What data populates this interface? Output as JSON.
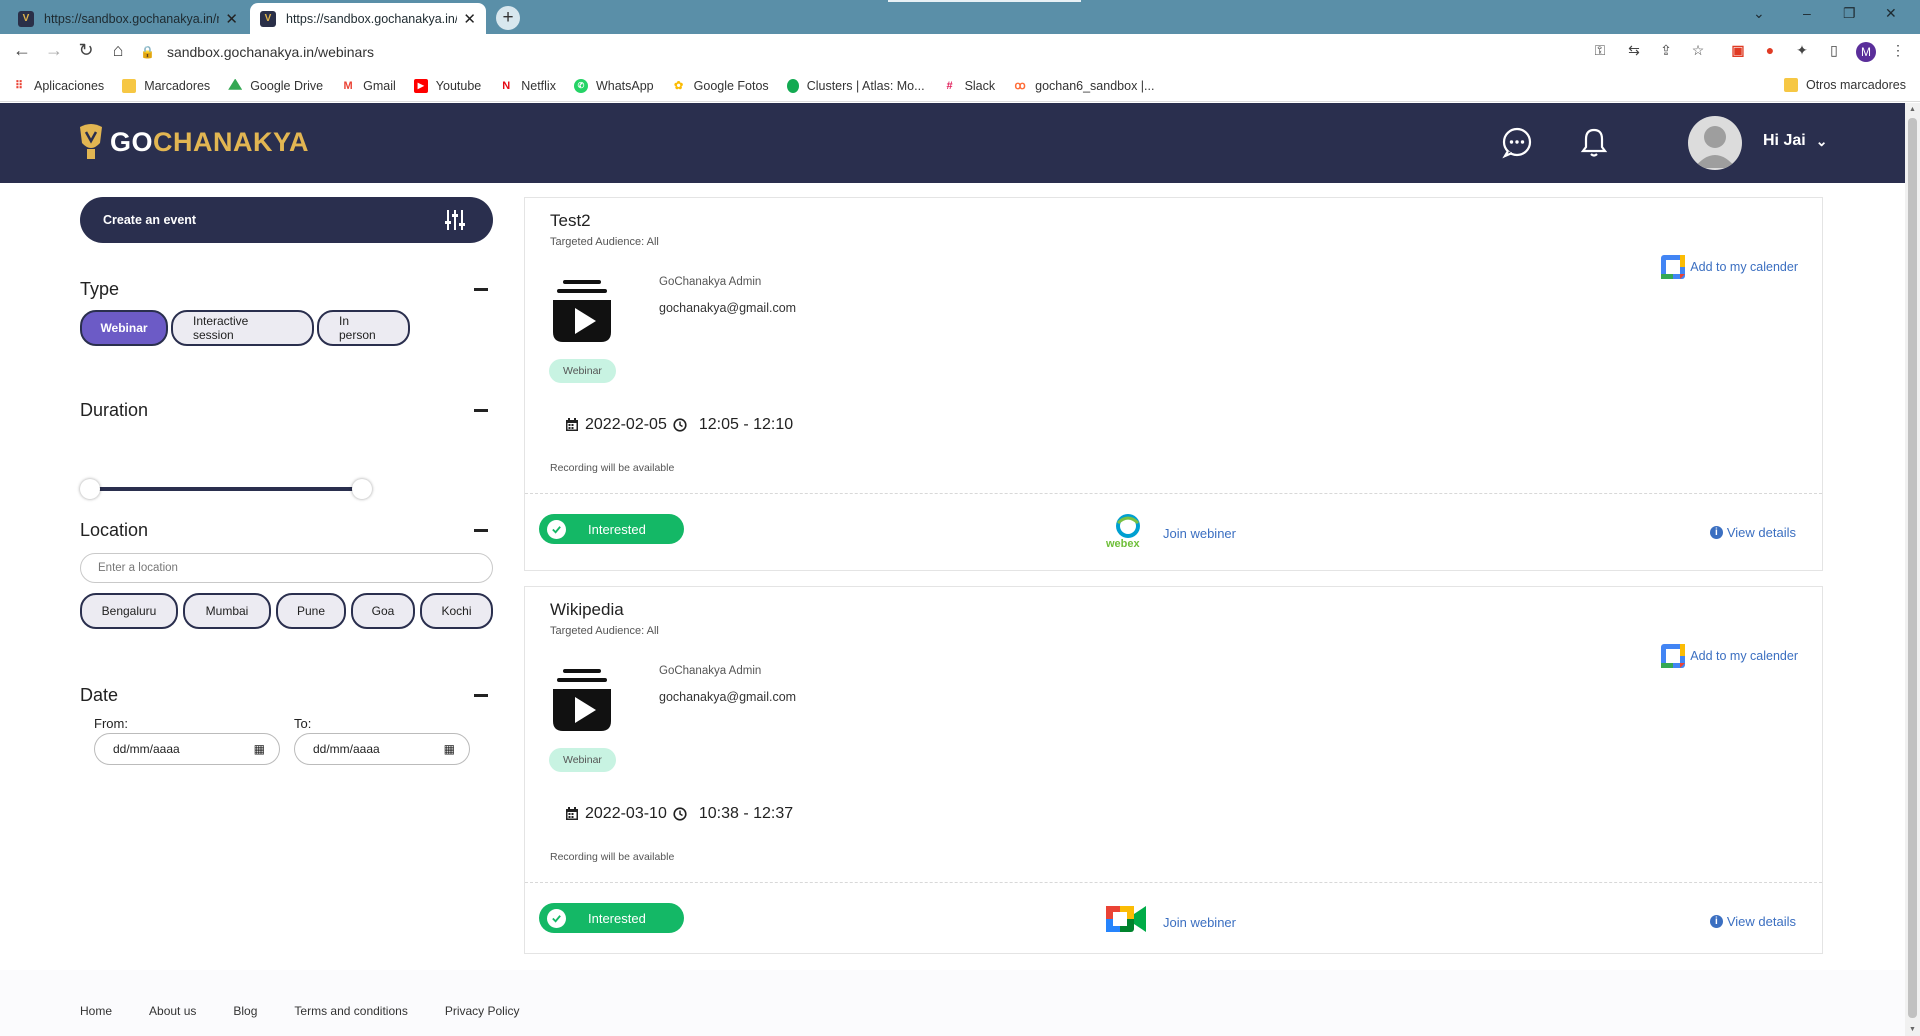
{
  "browser": {
    "tabs": [
      {
        "title": "https://sandbox.gochanakya.in/m",
        "active": false
      },
      {
        "title": "https://sandbox.gochanakya.in/w",
        "active": true
      }
    ],
    "address": "sandbox.gochanakya.in/webinars",
    "bookmarks": [
      {
        "label": "Aplicaciones",
        "icon": "apps-grid-icon"
      },
      {
        "label": "Marcadores",
        "icon": "folder-icon"
      },
      {
        "label": "Google Drive",
        "icon": "google-drive-icon"
      },
      {
        "label": "Gmail",
        "icon": "gmail-icon"
      },
      {
        "label": "Youtube",
        "icon": "youtube-icon"
      },
      {
        "label": "Netflix",
        "icon": "netflix-icon"
      },
      {
        "label": "WhatsApp",
        "icon": "whatsapp-icon"
      },
      {
        "label": "Google Fotos",
        "icon": "google-photos-icon"
      },
      {
        "label": "Clusters | Atlas: Mo...",
        "icon": "mongodb-icon"
      },
      {
        "label": "Slack",
        "icon": "slack-icon"
      },
      {
        "label": "gochan6_sandbox |...",
        "icon": "postman-icon"
      }
    ],
    "other_bookmarks": "Otros marcadores",
    "profile_initial": "M"
  },
  "site": {
    "logo_text_1": "GO",
    "logo_text_2": "CHANAKYA",
    "greeting": "Hi Jai"
  },
  "sidebar": {
    "create_event": "Create an event",
    "type": {
      "heading": "Type",
      "options": [
        {
          "label": "Webinar",
          "selected": true
        },
        {
          "label": "Interactive session",
          "selected": false
        },
        {
          "label": "In person",
          "selected": false
        }
      ]
    },
    "duration": {
      "heading": "Duration",
      "range_min": 0,
      "range_max": 1
    },
    "location": {
      "heading": "Location",
      "placeholder": "Enter a location",
      "cities": [
        "Bengaluru",
        "Mumbai",
        "Pune",
        "Goa",
        "Kochi"
      ]
    },
    "date": {
      "heading": "Date",
      "from_label": "From:",
      "to_label": "To:",
      "from_value": "dd/mm/aaaa",
      "to_value": "dd/mm/aaaa"
    }
  },
  "events": [
    {
      "title": "Test2",
      "audience": "Targeted Audience: All",
      "calendar_link": "Add to my calender",
      "host_name": "GoChanakya Admin",
      "host_email": "gochanakya@gmail.com",
      "type": "Webinar",
      "date": "2022-02-05",
      "time": "12:05 - 12:10",
      "recording_note": "Recording will be available",
      "interest_label": "Interested",
      "platform": "webex",
      "join_label": "Join webiner",
      "details_label": "View details"
    },
    {
      "title": "Wikipedia",
      "audience": "Targeted Audience: All",
      "calendar_link": "Add to my calender",
      "host_name": "GoChanakya Admin",
      "host_email": "gochanakya@gmail.com",
      "type": "Webinar",
      "date": "2022-03-10",
      "time": "10:38 - 12:37",
      "recording_note": "Recording will be available",
      "interest_label": "Interested",
      "platform": "google-meet",
      "join_label": "Join webiner",
      "details_label": "View details"
    }
  ],
  "footer": {
    "links": [
      "Home",
      "About us",
      "Blog",
      "Terms and conditions",
      "Privacy Policy"
    ]
  },
  "colors": {
    "header_bg": "#2a2f4e",
    "brand_gold": "#e2b652",
    "chip_selected": "#6c5bc6",
    "interested_green": "#14b866",
    "link_blue": "#3b6fc1",
    "badge_mint": "#c8f3e2"
  }
}
